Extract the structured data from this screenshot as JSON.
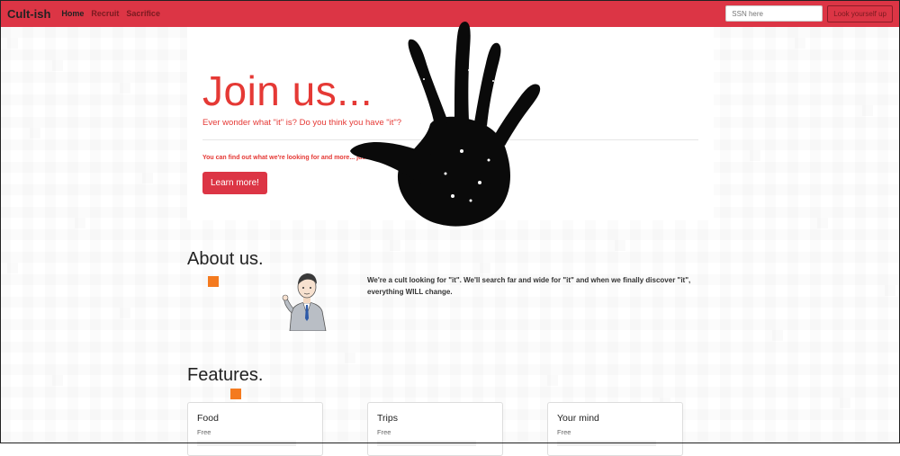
{
  "navbar": {
    "brand": "Cult-ish",
    "items": [
      {
        "label": "Home",
        "active": true
      },
      {
        "label": "Recruit",
        "active": false
      },
      {
        "label": "Sacrifice",
        "active": false
      }
    ],
    "search_placeholder": "SSN here",
    "lookup_button": "Look yourself up"
  },
  "jumbotron": {
    "title": "Join us...",
    "lead": "Ever wonder what \"it\" is? Do you think you have \"it\"?",
    "note": "You can find out what we're looking for and more... just click the button below!",
    "button": "Learn more!"
  },
  "about": {
    "title": "About us.",
    "text": "We're a cult looking for \"it\". We'll search far and wide for \"it\" and when we finally discover \"it\", everything WILL change."
  },
  "features": {
    "title": "Features.",
    "cards": [
      {
        "title": "Food",
        "subtitle": "Free"
      },
      {
        "title": "Trips",
        "subtitle": "Free"
      },
      {
        "title": "Your mind",
        "subtitle": "Free"
      }
    ]
  },
  "colors": {
    "brand_red": "#dc3545",
    "title_red": "#e53935",
    "accent_orange": "#f47a1f"
  },
  "icons": [
    "handprint-image",
    "businessman-illustration"
  ]
}
